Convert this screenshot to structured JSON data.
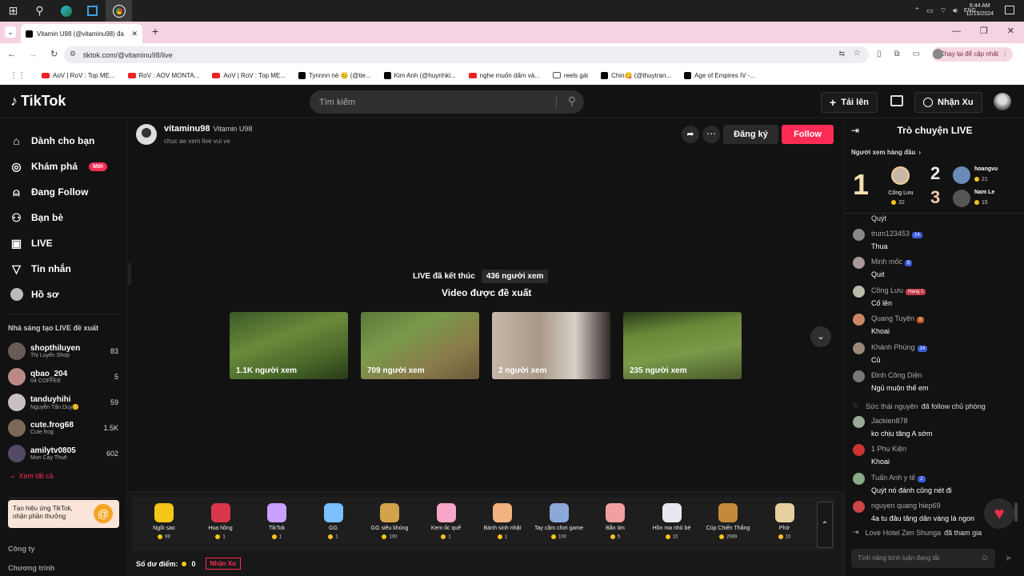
{
  "taskbar": {
    "time": "6:44 AM",
    "date": "11/15/2024",
    "lang": "ENG"
  },
  "browser": {
    "tab_title": "Vitamin U98 (@vitaminu98) đa",
    "url": "tiktok.com/@vitaminu98/live",
    "update_button": "Chạy lại để cập nhật",
    "bookmarks": [
      "AoV | RoV : Top ME...",
      "RoV : AOV MONTA...",
      "AoV | RoV : Top ME...",
      "Tynnnn nè 😊 (@tie...",
      "Kim Anh (@huynhki...",
      "nghe muốn dấm và...",
      "reels gái",
      "Chin😋 (@thuytran...",
      "Age of Empires IV -..."
    ]
  },
  "header": {
    "logo": "TikTok",
    "search_placeholder": "Tìm kiếm",
    "upload": "Tải lên",
    "coins": "Nhận Xu"
  },
  "sidebar": {
    "nav": [
      {
        "label": "Dành cho bạn",
        "icon": "home-icon"
      },
      {
        "label": "Khám phá",
        "icon": "compass-icon",
        "badge": "Mới"
      },
      {
        "label": "Đang Follow",
        "icon": "user-plus-icon"
      },
      {
        "label": "Bạn bè",
        "icon": "friends-icon"
      },
      {
        "label": "LIVE",
        "icon": "live-icon"
      },
      {
        "label": "Tin nhắn",
        "icon": "send-icon"
      },
      {
        "label": "Hồ sơ",
        "icon": "profile-icon"
      }
    ],
    "creators_title": "Nhà sáng tạo LIVE đề xuất",
    "creators": [
      {
        "name": "shopthiluyen",
        "sub": "Thị Luyến Shop",
        "count": "83"
      },
      {
        "name": "qbao_204",
        "sub": "04 COFFEE",
        "count": "5"
      },
      {
        "name": "tanduyhihi",
        "sub": "Nguyễn Tấn Duy😊",
        "count": "59"
      },
      {
        "name": "cute.frog68",
        "sub": "Cute frog",
        "count": "1.5K"
      },
      {
        "name": "amilytv0805",
        "sub": "Mon Cày Thuê",
        "count": "602"
      }
    ],
    "see_all": "Xem tất cả",
    "promo": "Tạo hiệu ứng TikTok, nhận phần thưởng",
    "footer1": "Công ty",
    "footer2": "Chương trình"
  },
  "stream": {
    "username": "vitaminu98",
    "display_name": "Vitamin U98",
    "bio": "chuc ae xem live vui ve",
    "subscribe": "Đăng ký",
    "follow": "Follow",
    "ended": "LIVE đã kết thúc",
    "viewers": "436 người xem",
    "suggested": "Video được đề xuất",
    "thumbs": [
      "1.1K người xem",
      "709 người xem",
      "2 người xem",
      "235 người xem"
    ]
  },
  "gifts": [
    {
      "name": "Ngôi sao",
      "price": "99",
      "color": "#f5c518"
    },
    {
      "name": "Hoa hồng",
      "price": "1",
      "color": "#d9364a"
    },
    {
      "name": "TikTok",
      "price": "1",
      "color": "#c9a0ff"
    },
    {
      "name": "GG",
      "price": "1",
      "color": "#7ac0ff"
    },
    {
      "name": "GG siêu khủng",
      "price": "100",
      "color": "#d2a34a"
    },
    {
      "name": "Kem ốc quế",
      "price": "1",
      "color": "#f7a6c8"
    },
    {
      "name": "Bánh sinh nhật",
      "price": "1",
      "color": "#f2b380"
    },
    {
      "name": "Tay cầm chơi game",
      "price": "100",
      "color": "#8aa8d8"
    },
    {
      "name": "Bắn tim",
      "price": "5",
      "color": "#f0a0a0"
    },
    {
      "name": "Hồn ma nhỏ bé",
      "price": "10",
      "color": "#e8e8f0"
    },
    {
      "name": "Cúp Chiến Thắng",
      "price": "2999",
      "color": "#c48a3a"
    },
    {
      "name": "Phở",
      "price": "10",
      "color": "#e6d0a0"
    }
  ],
  "balance": {
    "label": "Số dư điểm:",
    "value": "0",
    "button": "Nhận Xu"
  },
  "chat": {
    "title": "Trò chuyện LIVE",
    "top_viewers": "Người xem hàng đầu",
    "rank1": {
      "rank": "1",
      "name": "Công Lưu",
      "score": "32"
    },
    "rank2": {
      "rank": "2",
      "name": "hoangvu",
      "score": "21"
    },
    "rank3": {
      "rank": "3",
      "name": "Nam Le",
      "score": "15"
    },
    "partial": "Quýt",
    "messages": [
      {
        "name": "trum123453",
        "level": "14",
        "text": "Thua"
      },
      {
        "name": "Minh mốc",
        "level": "8",
        "text": "Quit"
      },
      {
        "name": "Công Lưu",
        "level": "Hạng 1",
        "text": "Cố lên"
      },
      {
        "name": "Quang Tuyên",
        "level": "II",
        "text": "Khoai"
      },
      {
        "name": "Khánh Phùng",
        "level": "14",
        "text": "Củ"
      },
      {
        "name": "Đinh Công Diện",
        "level": "",
        "text": "Ngủ muộn thế em"
      },
      {
        "name": "Jackien878",
        "level": "",
        "text": "ko chịu tăng A sớm"
      },
      {
        "name": "1 Phụ Kiện",
        "level": "",
        "text": "Khoai"
      },
      {
        "name": "Tuấn Anh y tế",
        "level": "2",
        "text": "Quýt nó đánh cũng nét đi"
      },
      {
        "name": "nguyen quang hiep69",
        "level": "",
        "text": "4a tu đâu tăng dân vàng là ngon"
      }
    ],
    "event1_name": "Sức thái nguyên",
    "event1_text": "đã follow chủ phòng",
    "event2_name": "Love Hotel Zen Shunga",
    "event2_text": "đã tham gia",
    "input_placeholder": "Tính năng bình luận đang tắt"
  }
}
